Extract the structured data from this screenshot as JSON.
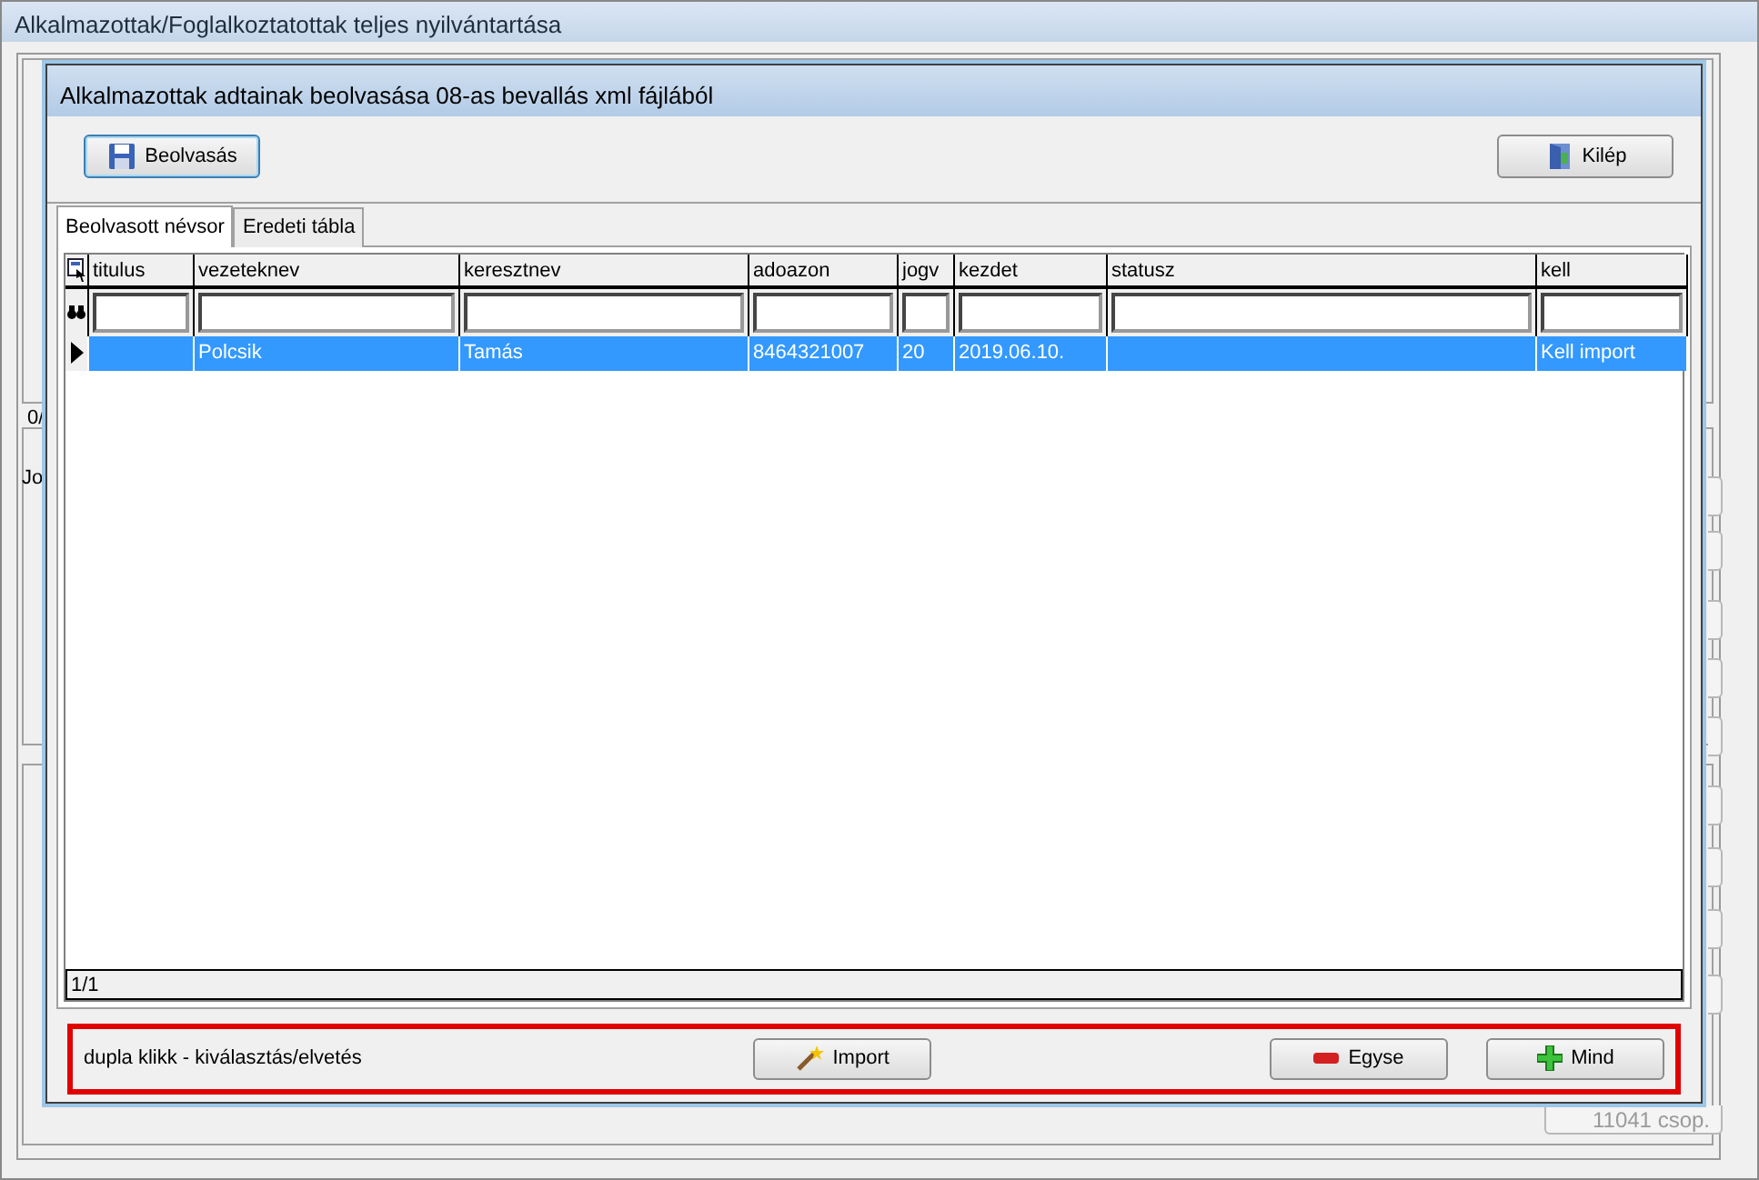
{
  "background_window": {
    "title": "Alkalmazottak/Foglalkoztatottak teljes nyilvántartása",
    "partial_labels": [
      "0/",
      "Jo"
    ],
    "side_button": {
      "label": "11041 csop.",
      "disabled": true
    }
  },
  "dialog": {
    "title": "Alkalmazottak adtainak beolvasása 08-as bevallás xml fájlából",
    "toolbar": [
      {
        "label": "Beolvasás",
        "focused": true
      },
      {
        "label": "Kilép",
        "focused": false
      }
    ],
    "tabs": [
      {
        "label": "Beolvasott névsor",
        "selected": true
      },
      {
        "label": "Eredeti tábla",
        "selected": false
      }
    ],
    "grid": {
      "columns": [
        "titulus",
        "vezeteknev",
        "keresztnev",
        "adoazon",
        "jogv",
        "kezdet",
        "statusz",
        "kell"
      ],
      "rows": [
        {
          "cells": [
            "",
            "Polcsik",
            "Tamás",
            "8464321007",
            "20",
            "2019.06.10.",
            "",
            "Kell import"
          ],
          "selected": true
        }
      ],
      "status": "1/1"
    },
    "footer": {
      "hint": "dupla klikk - kiválasztás/elvetés",
      "buttons": [
        {
          "label": "Import"
        },
        {
          "label": "Egyse"
        },
        {
          "label": "Mind"
        }
      ]
    }
  }
}
